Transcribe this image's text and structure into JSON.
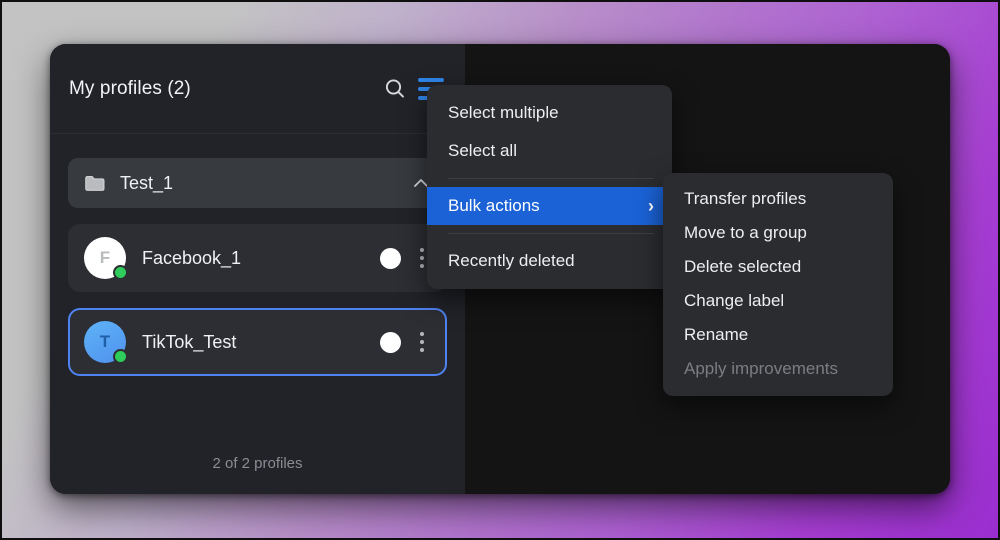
{
  "window": {
    "sidebar": {
      "header": {
        "title": "My profiles (2)",
        "search_icon": "search-icon",
        "menu_icon": "hamburger-menu-icon"
      },
      "group": {
        "name": "Test_1",
        "folder_icon": "folder-icon",
        "chevron": "chevron-up-icon"
      },
      "profiles": [
        {
          "name": "Facebook_1",
          "avatar_initial": "F",
          "avatar_style": "light",
          "status": "online",
          "selected": false
        },
        {
          "name": "TikTok_Test",
          "avatar_initial": "T",
          "avatar_style": "blue",
          "status": "online",
          "selected": true
        }
      ],
      "footer_text": "2 of 2 profiles"
    }
  },
  "dropdown_menu": {
    "items": [
      {
        "label": "Select multiple",
        "highlight": false,
        "separator_after": false,
        "submenu": false
      },
      {
        "label": "Select all",
        "highlight": false,
        "separator_after": true,
        "submenu": false
      },
      {
        "label": "Bulk actions",
        "highlight": true,
        "separator_after": true,
        "submenu": true,
        "arrow": "›"
      },
      {
        "label": "Recently deleted",
        "highlight": false,
        "separator_after": false,
        "submenu": false
      }
    ]
  },
  "submenu": {
    "items": [
      {
        "label": "Transfer profiles",
        "disabled": false
      },
      {
        "label": "Move to a group",
        "disabled": false
      },
      {
        "label": "Delete selected",
        "disabled": false
      },
      {
        "label": "Change label",
        "disabled": false
      },
      {
        "label": "Rename",
        "disabled": false
      },
      {
        "label": "Apply improvements",
        "disabled": true
      }
    ]
  },
  "colors": {
    "accent_blue": "#1a62d6",
    "icon_blue": "#2f85e8",
    "selection_border": "#4f83f1",
    "status_green": "#2ecc5a",
    "sidebar_bg": "#212329",
    "content_bg": "#141414",
    "menu_bg": "#2b2c30",
    "wallpaper_from": "#c3c3c3",
    "wallpaper_to": "#9b2ed0"
  }
}
